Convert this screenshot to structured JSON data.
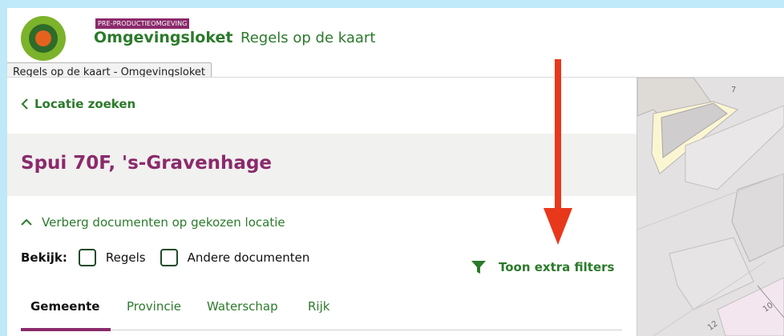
{
  "header": {
    "environment_badge": "PRE-PRODUCTIEOMGEVING",
    "brand": "Omgevingsloket",
    "app_title": "Regels op de kaart",
    "tooltip": "Regels op de kaart - Omgevingsloket"
  },
  "panel": {
    "back_link": "Locatie zoeken",
    "location_title": "Spui 70F, 's-Gravenhage",
    "toggle_documents": "Verberg documenten op gekozen locatie",
    "view_label": "Bekijk:",
    "checkboxes": [
      {
        "label": "Regels",
        "checked": false
      },
      {
        "label": "Andere documenten",
        "checked": false
      }
    ],
    "extra_filters": "Toon extra filters",
    "tabs": [
      {
        "label": "Gemeente",
        "active": true
      },
      {
        "label": "Provincie",
        "active": false
      },
      {
        "label": "Waterschap",
        "active": false
      },
      {
        "label": "Rijk",
        "active": false
      }
    ]
  },
  "map": {
    "labels": [
      "7",
      "10",
      "12"
    ]
  },
  "colors": {
    "brand_green": "#2b7a2b",
    "accent_purple": "#8a2a6b",
    "annotation_red": "#e8381c",
    "frame_background": "#bfe9f8"
  }
}
